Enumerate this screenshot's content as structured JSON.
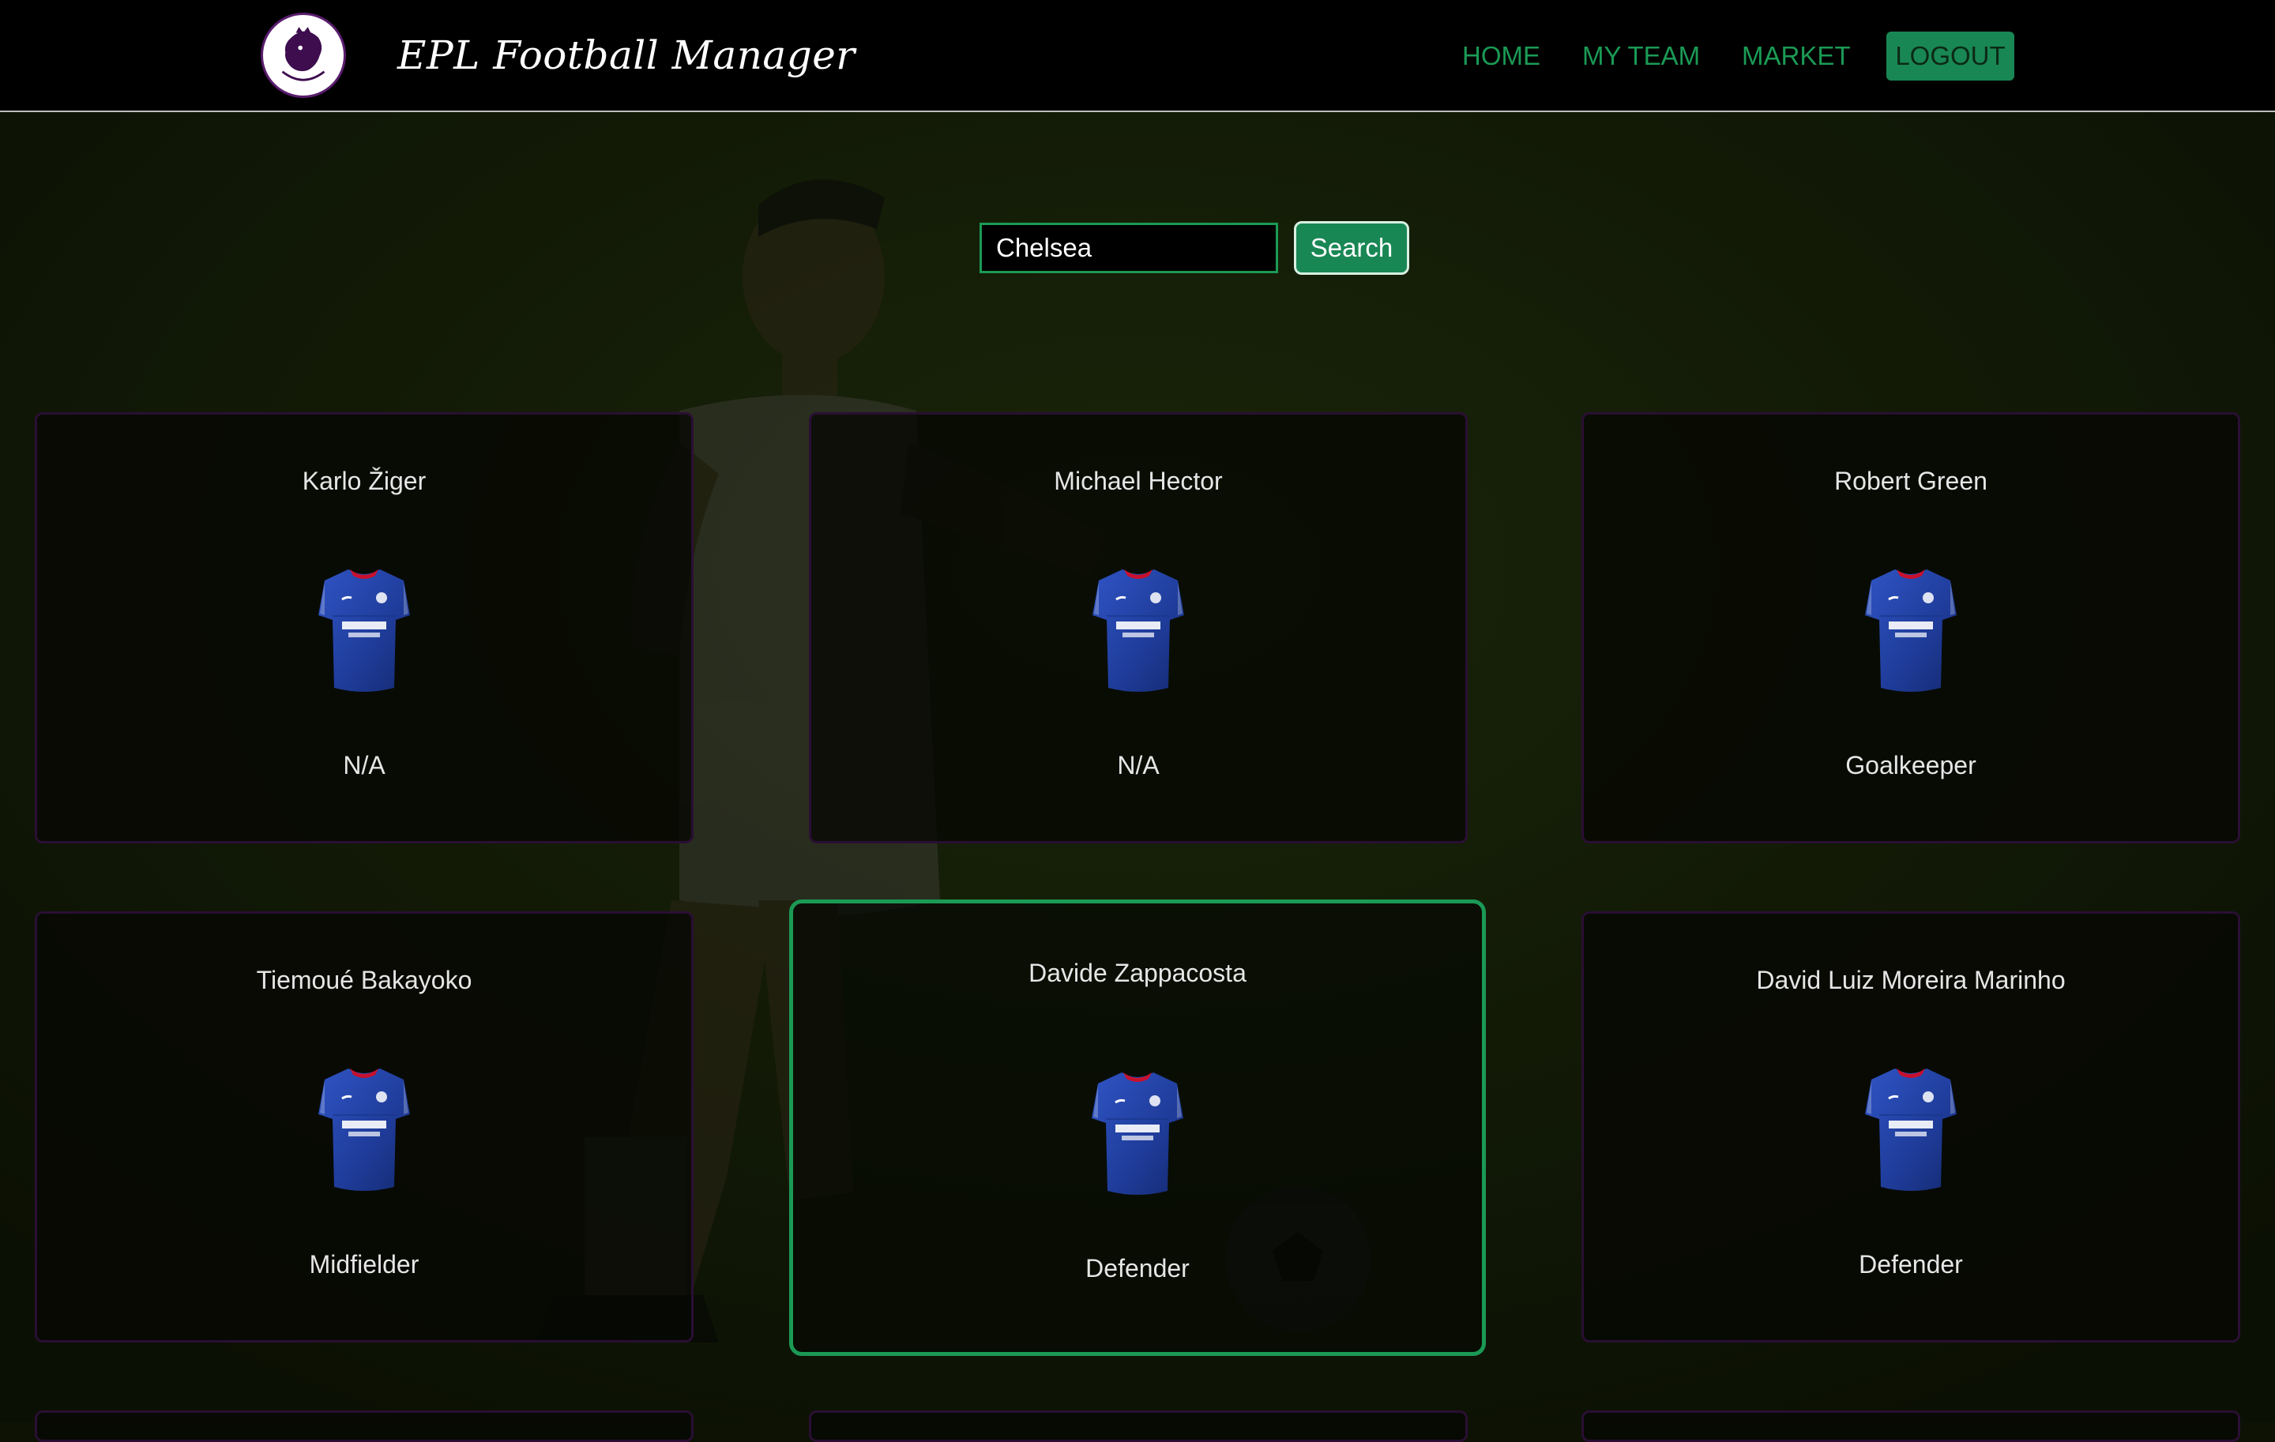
{
  "app": {
    "title": "EPL Football Manager",
    "logo_icon": "premier-league-lion-icon"
  },
  "nav": {
    "home": "HOME",
    "my_team": "MY TEAM",
    "market": "MARKET",
    "logout": "LOGOUT"
  },
  "search": {
    "value": "Chelsea",
    "button": "Search"
  },
  "colors": {
    "accent": "#198754",
    "link": "#1b9a55",
    "background": "#0d1205",
    "card_border": "#2a0f33"
  },
  "players": [
    {
      "name": "Karlo Žiger",
      "position": "N/A",
      "jersey_icon": "chelsea-jersey-icon"
    },
    {
      "name": "Michael Hector",
      "position": "N/A",
      "jersey_icon": "chelsea-jersey-icon"
    },
    {
      "name": "Robert Green",
      "position": "Goalkeeper",
      "jersey_icon": "chelsea-jersey-icon"
    },
    {
      "name": "Tiemoué Bakayoko",
      "position": "Midfielder",
      "jersey_icon": "chelsea-jersey-icon"
    },
    {
      "name": "Davide Zappacosta",
      "position": "Defender",
      "jersey_icon": "chelsea-jersey-icon"
    },
    {
      "name": "David Luiz Moreira Marinho",
      "position": "Defender",
      "jersey_icon": "chelsea-jersey-icon"
    }
  ]
}
